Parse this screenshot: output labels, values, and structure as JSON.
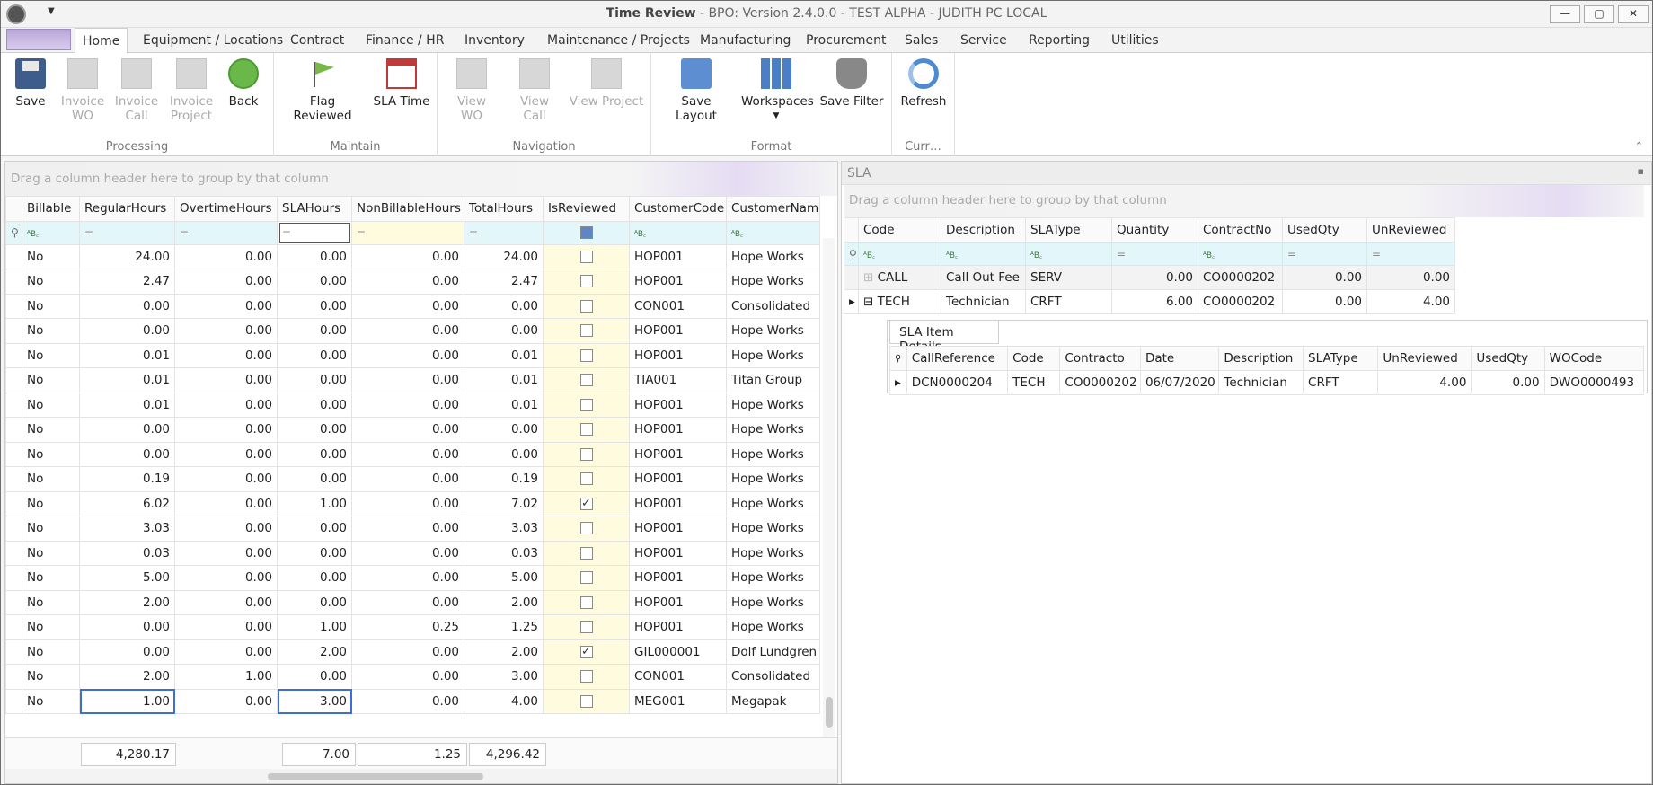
{
  "window": {
    "title_bold": "Time Review",
    "title_rest": " - BPO: Version 2.4.0.0 - TEST ALPHA - JUDITH PC LOCAL",
    "min": "—",
    "max": "▢",
    "close": "✕"
  },
  "tabs": [
    "Home",
    "Equipment / Locations",
    "Contract",
    "Finance / HR",
    "Inventory",
    "Maintenance / Projects",
    "Manufacturing",
    "Procurement",
    "Sales",
    "Service",
    "Reporting",
    "Utilities"
  ],
  "ribbon": {
    "processing": {
      "label": "Processing",
      "save": "Save",
      "invoice_wo": "Invoice WO",
      "invoice_call": "Invoice Call",
      "invoice_project": "Invoice Project",
      "back": "Back"
    },
    "maintain": {
      "label": "Maintain",
      "flag_reviewed": "Flag Reviewed",
      "sla_time": "SLA Time"
    },
    "navigation": {
      "label": "Navigation",
      "view_wo": "View WO",
      "view_call": "View Call",
      "view_project": "View Project"
    },
    "format": {
      "label": "Format",
      "save_layout": "Save Layout",
      "workspaces": "Workspaces",
      "save_filter": "Save Filter"
    },
    "curr": {
      "label": "Curr…",
      "refresh": "Refresh"
    }
  },
  "time_grid": {
    "group_hint": "Drag a column header here to group by that column",
    "columns": [
      "Billable",
      "RegularHours",
      "OvertimeHours",
      "SLAHours",
      "NonBillableHours",
      "TotalHours",
      "IsReviewed",
      "CustomerCode",
      "CustomerName"
    ],
    "rows": [
      [
        "No",
        "24.00",
        "0.00",
        "0.00",
        "0.00",
        "24.00",
        false,
        "HOP001",
        "Hope Works"
      ],
      [
        "No",
        "2.47",
        "0.00",
        "0.00",
        "0.00",
        "2.47",
        false,
        "HOP001",
        "Hope Works"
      ],
      [
        "No",
        "0.00",
        "0.00",
        "0.00",
        "0.00",
        "0.00",
        false,
        "CON001",
        "Consolidated"
      ],
      [
        "No",
        "0.00",
        "0.00",
        "0.00",
        "0.00",
        "0.00",
        false,
        "HOP001",
        "Hope Works"
      ],
      [
        "No",
        "0.01",
        "0.00",
        "0.00",
        "0.00",
        "0.01",
        false,
        "HOP001",
        "Hope Works"
      ],
      [
        "No",
        "0.01",
        "0.00",
        "0.00",
        "0.00",
        "0.01",
        false,
        "TIA001",
        "Titan Group"
      ],
      [
        "No",
        "0.01",
        "0.00",
        "0.00",
        "0.00",
        "0.01",
        false,
        "HOP001",
        "Hope Works"
      ],
      [
        "No",
        "0.00",
        "0.00",
        "0.00",
        "0.00",
        "0.00",
        false,
        "HOP001",
        "Hope Works"
      ],
      [
        "No",
        "0.00",
        "0.00",
        "0.00",
        "0.00",
        "0.00",
        false,
        "HOP001",
        "Hope Works"
      ],
      [
        "No",
        "0.19",
        "0.00",
        "0.00",
        "0.00",
        "0.19",
        false,
        "HOP001",
        "Hope Works"
      ],
      [
        "No",
        "6.02",
        "0.00",
        "1.00",
        "0.00",
        "7.02",
        true,
        "HOP001",
        "Hope Works"
      ],
      [
        "No",
        "3.03",
        "0.00",
        "0.00",
        "0.00",
        "3.03",
        false,
        "HOP001",
        "Hope Works"
      ],
      [
        "No",
        "0.03",
        "0.00",
        "0.00",
        "0.00",
        "0.03",
        false,
        "HOP001",
        "Hope Works"
      ],
      [
        "No",
        "5.00",
        "0.00",
        "0.00",
        "0.00",
        "5.00",
        false,
        "HOP001",
        "Hope Works"
      ],
      [
        "No",
        "2.00",
        "0.00",
        "0.00",
        "0.00",
        "2.00",
        false,
        "HOP001",
        "Hope Works"
      ],
      [
        "No",
        "0.00",
        "0.00",
        "1.00",
        "0.25",
        "1.25",
        false,
        "HOP001",
        "Hope Works"
      ],
      [
        "No",
        "0.00",
        "0.00",
        "2.00",
        "0.00",
        "2.00",
        true,
        "GIL000001",
        "Dolf Lundgren"
      ],
      [
        "No",
        "2.00",
        "1.00",
        "0.00",
        "0.00",
        "3.00",
        false,
        "CON001",
        "Consolidated"
      ],
      [
        "No",
        "1.00",
        "0.00",
        "3.00",
        "0.00",
        "4.00",
        false,
        "MEG001",
        "Megapak"
      ]
    ],
    "totals": {
      "regular": "4,280.17",
      "sla": "7.00",
      "nonbillable": "1.25",
      "total": "4,296.42"
    }
  },
  "sla_panel": {
    "title": "SLA",
    "group_hint": "Drag a column header here to group by that column",
    "columns": [
      "Code",
      "Description",
      "SLAType",
      "Quantity",
      "ContractNo",
      "UsedQty",
      "UnReviewed"
    ],
    "rows": [
      [
        "CALL",
        "Call Out Fee",
        "SERV",
        "0.00",
        "CO0000202",
        "0.00",
        "0.00"
      ],
      [
        "TECH",
        "Technician",
        "CRFT",
        "6.00",
        "CO0000202",
        "0.00",
        "4.00"
      ]
    ],
    "detail": {
      "tab": "SLA Item Details",
      "columns": [
        "CallReference",
        "Code",
        "Contracto",
        "Date",
        "Description",
        "SLAType",
        "UnReviewed",
        "UsedQty",
        "WOCode"
      ],
      "rows": [
        [
          "DCN0000204",
          "TECH",
          "CO0000202",
          "06/07/2020",
          "Technician",
          "CRFT",
          "4.00",
          "0.00",
          "DWO0000493"
        ]
      ]
    }
  }
}
